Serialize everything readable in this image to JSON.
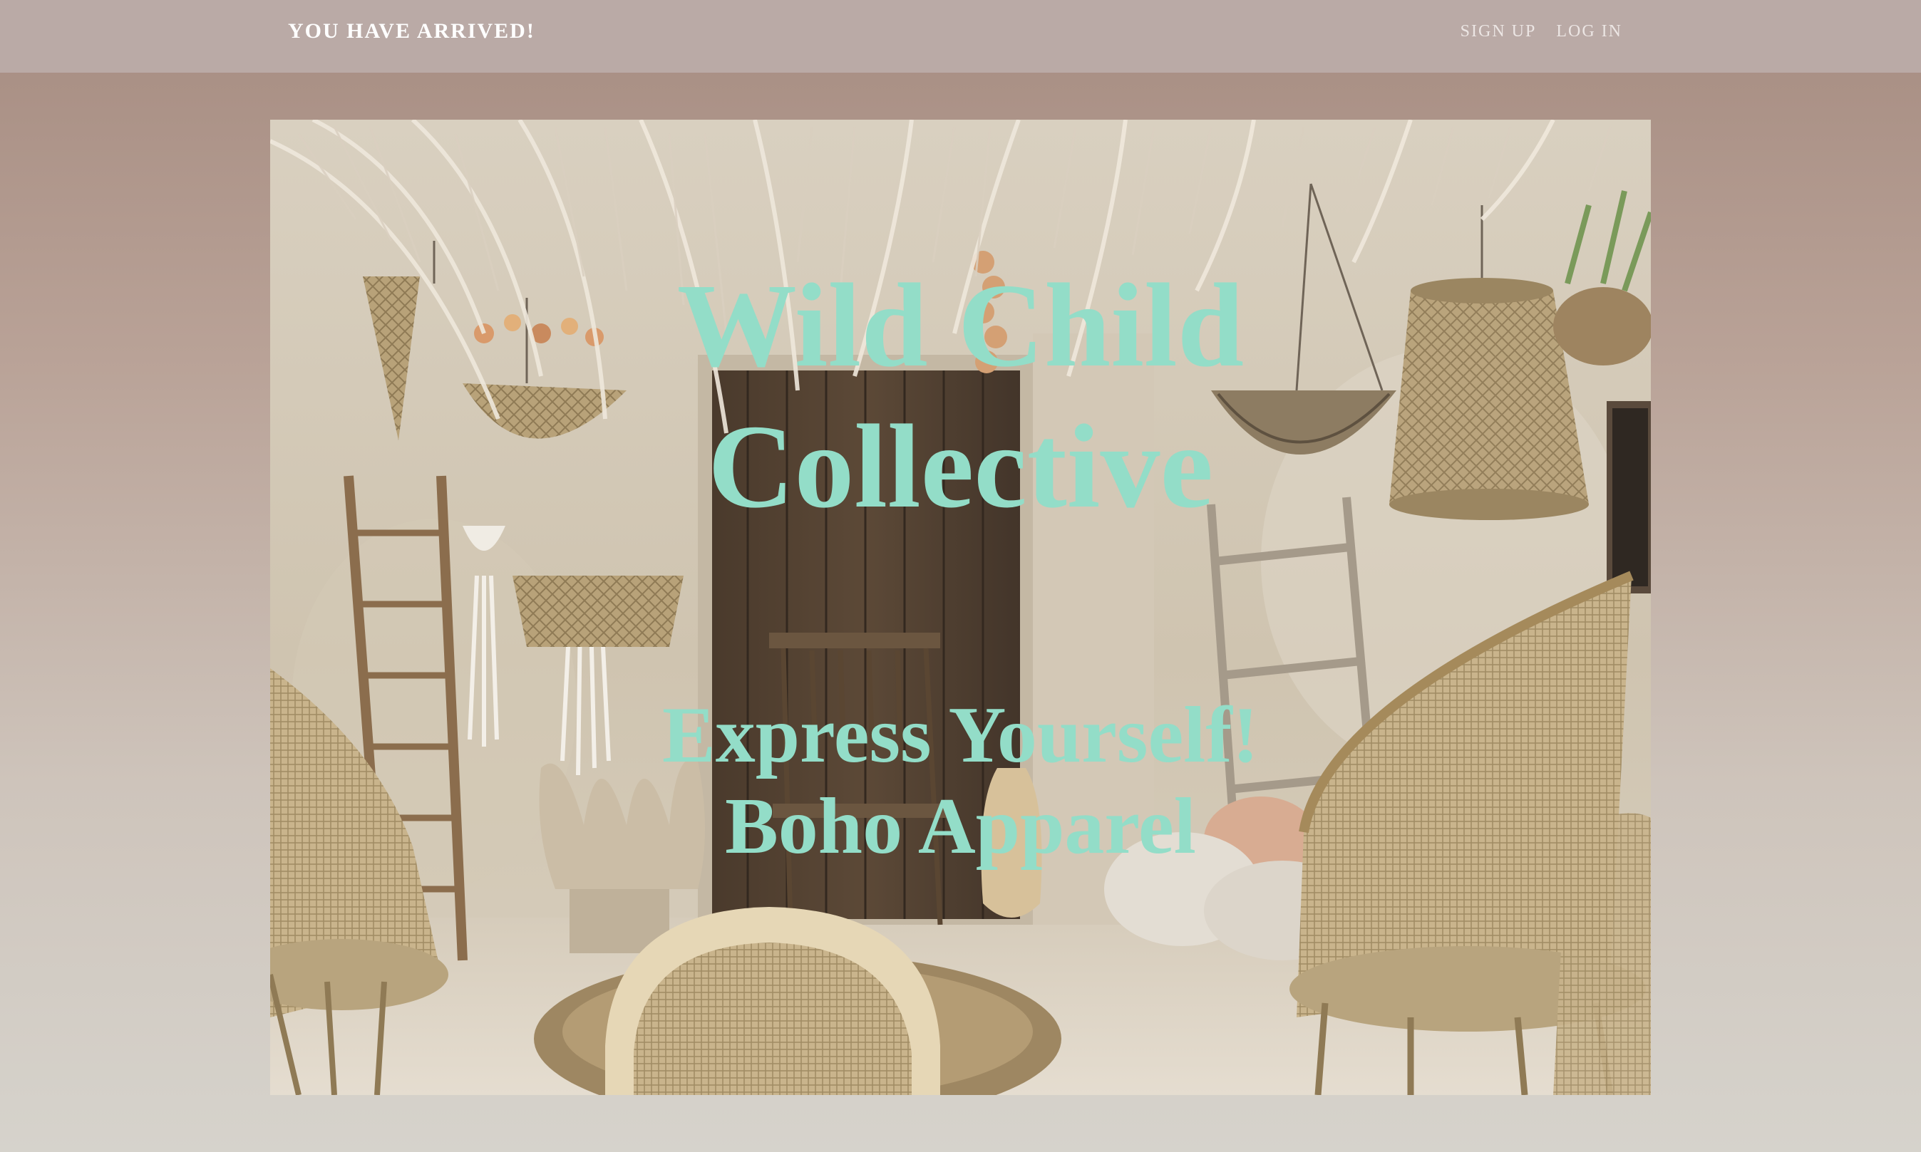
{
  "nav": {
    "brand": "YOU HAVE ARRIVED!",
    "links": [
      {
        "label": "SIGN UP"
      },
      {
        "label": "LOG IN"
      }
    ]
  },
  "hero": {
    "title_line1": "Wild Child",
    "title_line2": "Collective",
    "tagline_line1": "Express Yourself!",
    "tagline_line2": "Boho Apparel"
  },
  "colors": {
    "navbar": "#baaaa6",
    "accent_text": "#93ddc8",
    "background_top": "#a68c81",
    "background_bottom": "#d6d3cc"
  }
}
